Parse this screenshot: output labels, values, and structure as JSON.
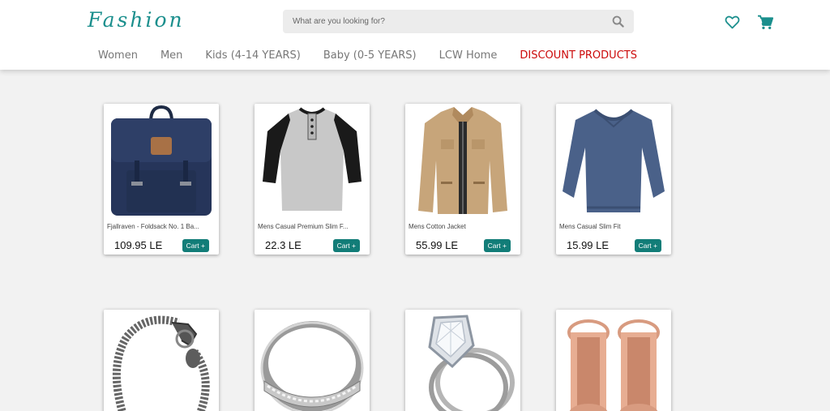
{
  "header": {
    "logo": "Fashion",
    "search_placeholder": "What are you looking for?",
    "icons": [
      "search-icon",
      "heart-icon",
      "cart-icon"
    ],
    "accent_color": "#1b8f8d"
  },
  "nav": {
    "items": [
      "Women",
      "Men",
      "Kids (4-14 YEARS)",
      "Baby (0-5 YEARS)",
      "LCW Home",
      "DISCOUNT PRODUCTS"
    ],
    "discount_color": "#cc0a0a"
  },
  "products": [
    {
      "name": "Fjallraven - Foldsack No. 1 Ba...",
      "price": "109.95 LE",
      "cart_label": "Cart +"
    },
    {
      "name": "Mens Casual Premium Slim F...",
      "price": "22.3 LE",
      "cart_label": "Cart +"
    },
    {
      "name": "Mens Cotton Jacket",
      "price": "55.99 LE",
      "cart_label": "Cart +"
    },
    {
      "name": "Mens Casual Slim Fit",
      "price": "15.99 LE",
      "cart_label": "Cart +"
    }
  ],
  "cart_button_color": "#127d78"
}
